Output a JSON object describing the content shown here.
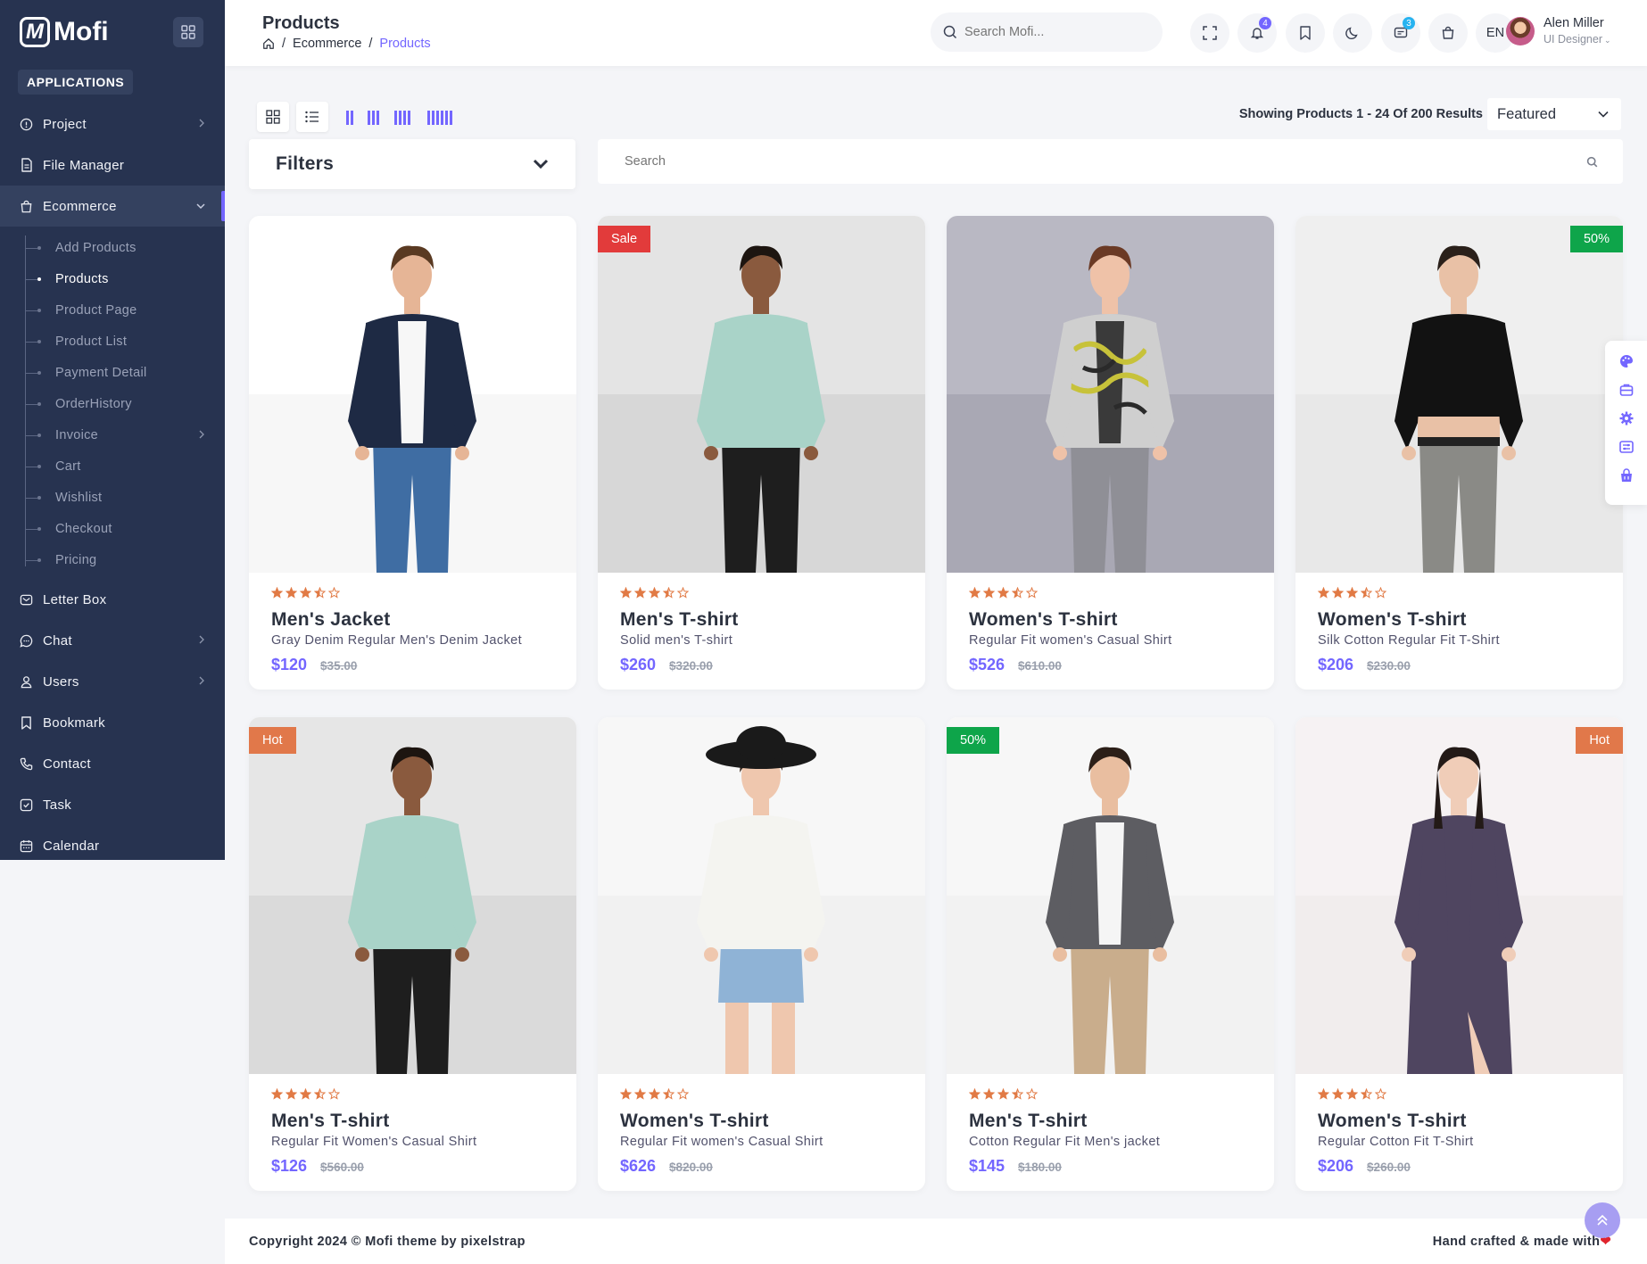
{
  "app": {
    "name": "Mofi",
    "section_label": "APPLICATIONS"
  },
  "colors": {
    "primary": "#7366ff",
    "sidebar_bg": "#273350",
    "star": "#e17a45",
    "ribbon_sale": "#e23b3b",
    "ribbon_discount": "#0ea54a",
    "ribbon_hot": "#e1784a"
  },
  "sidebar": {
    "items": [
      {
        "label": "Project",
        "icon": "info-circle-icon",
        "has_arrow": true
      },
      {
        "label": "File Manager",
        "icon": "file-icon",
        "has_arrow": false
      },
      {
        "label": "Ecommerce",
        "icon": "shopping-bag-icon",
        "has_arrow": true,
        "expanded": true
      }
    ],
    "ecommerce_sub": [
      {
        "label": "Add Products"
      },
      {
        "label": "Products",
        "active": true
      },
      {
        "label": "Product Page"
      },
      {
        "label": "Product List"
      },
      {
        "label": "Payment Detail"
      },
      {
        "label": "OrderHistory"
      },
      {
        "label": "Invoice",
        "has_arrow": true
      },
      {
        "label": "Cart"
      },
      {
        "label": "Wishlist"
      },
      {
        "label": "Checkout"
      },
      {
        "label": "Pricing"
      }
    ],
    "items_after": [
      {
        "label": "Letter Box",
        "icon": "mail-icon",
        "has_arrow": false
      },
      {
        "label": "Chat",
        "icon": "chat-icon",
        "has_arrow": true
      },
      {
        "label": "Users",
        "icon": "user-icon",
        "has_arrow": true
      },
      {
        "label": "Bookmark",
        "icon": "bookmark-icon",
        "has_arrow": false
      },
      {
        "label": "Contact",
        "icon": "phone-icon",
        "has_arrow": false
      },
      {
        "label": "Task",
        "icon": "task-icon",
        "has_arrow": false
      },
      {
        "label": "Calendar",
        "icon": "calendar-icon",
        "has_arrow": false
      }
    ]
  },
  "header": {
    "title": "Products",
    "breadcrumb": [
      "Ecommerce",
      "Products"
    ],
    "search_placeholder": "Search Mofi...",
    "notification_count": "4",
    "message_count": "3",
    "language": "EN",
    "user_name": "Alen Miller",
    "user_role": "UI Designer"
  },
  "toolbar": {
    "results_text": "Showing Products 1 - 24 Of 200 Results",
    "sort_value": "Featured",
    "filters_label": "Filters",
    "search_placeholder": "Search"
  },
  "products": [
    {
      "name": "Men's Jacket",
      "desc": "Gray Denim Regular Men's Denim Jacket",
      "price": "$120",
      "old_price": "$35.00",
      "ribbon": "",
      "ribbon_side": "left",
      "rating": 3.5
    },
    {
      "name": "Men's T-shirt",
      "desc": "Solid men's T-shirt",
      "price": "$260",
      "old_price": "$320.00",
      "ribbon": "Sale",
      "ribbon_side": "left",
      "rating": 3.5
    },
    {
      "name": "Women's T-shirt",
      "desc": "Regular Fit women's Casual Shirt",
      "price": "$526",
      "old_price": "$610.00",
      "ribbon": "",
      "ribbon_side": "left",
      "rating": 3.5
    },
    {
      "name": "Women's T-shirt",
      "desc": "Silk Cotton Regular Fit T-Shirt",
      "price": "$206",
      "old_price": "$230.00",
      "ribbon": "50%",
      "ribbon_side": "right",
      "rating": 3.5
    },
    {
      "name": "Men's T-shirt",
      "desc": "Regular Fit Women's Casual Shirt",
      "price": "$126",
      "old_price": "$560.00",
      "ribbon": "Hot",
      "ribbon_side": "left",
      "rating": 3.5
    },
    {
      "name": "Women's T-shirt",
      "desc": "Regular Fit women's Casual Shirt",
      "price": "$626",
      "old_price": "$820.00",
      "ribbon": "",
      "ribbon_side": "left",
      "rating": 3.5
    },
    {
      "name": "Men's T-shirt",
      "desc": "Cotton Regular Fit Men's jacket",
      "price": "$145",
      "old_price": "$180.00",
      "ribbon": "50%",
      "ribbon_side": "left",
      "rating": 3.5
    },
    {
      "name": "Women's T-shirt",
      "desc": "Regular Cotton Fit T-Shirt",
      "price": "$206",
      "old_price": "$260.00",
      "ribbon": "Hot",
      "ribbon_side": "right",
      "rating": 3.5
    }
  ],
  "footer": {
    "copyright": "Copyright 2024 © Mofi theme by pixelstrap",
    "made_with": "Hand crafted & made with"
  }
}
